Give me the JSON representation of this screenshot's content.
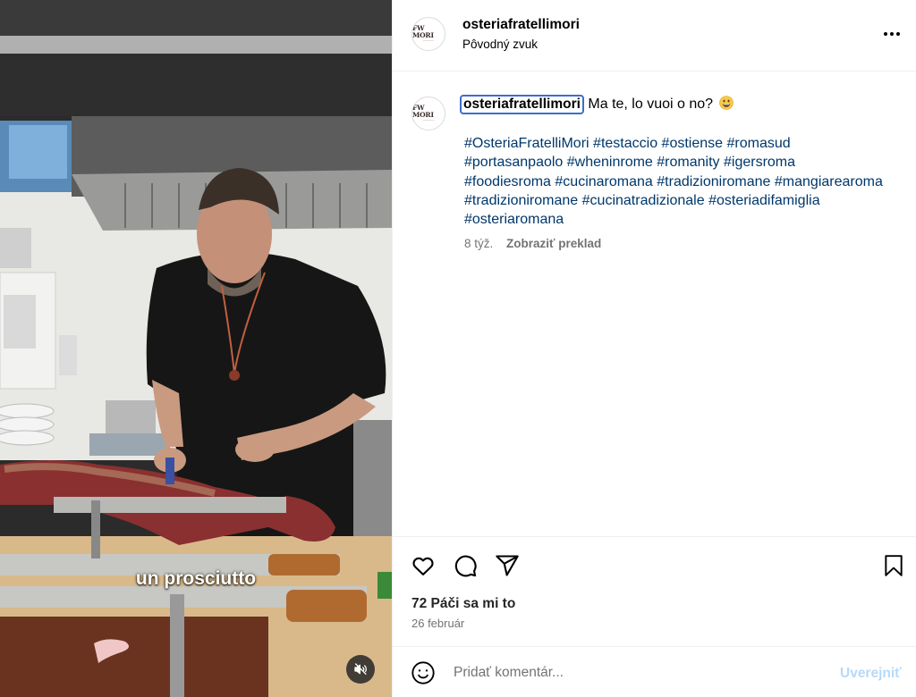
{
  "video": {
    "subtitle": "un prosciutto",
    "mute_icon": "speaker-muted-icon"
  },
  "header": {
    "avatar_logo": "FW MORI",
    "username": "osteriafratellimori",
    "audio": "Pôvodný zvuk",
    "more_icon": "more-horizontal-icon"
  },
  "caption": {
    "avatar_logo": "FW MORI",
    "username": "osteriafratellimori",
    "text": "Ma te, lo vuoi o no?",
    "emoji": "grinning-face-emoji",
    "hashtags": [
      "#OsteriaFratelliMori",
      "#testaccio",
      "#ostiense",
      "#romasud",
      "#portasanpaolo",
      "#wheninrome",
      "#romanity",
      "#igersroma",
      "#foodiesroma",
      "#cucinaromana",
      "#tradizioniromane",
      "#mangiarearoma",
      "#tradizioniromane",
      "#cucinatradizionale",
      "#osteriadifamiglia",
      "#osteriaromana"
    ],
    "age": "8 týž.",
    "translate": "Zobraziť preklad"
  },
  "actions": {
    "icons": [
      "heart-icon",
      "comment-icon",
      "share-icon",
      "bookmark-icon"
    ],
    "likes": "72 Páči sa mi to",
    "date": "26 február"
  },
  "comment": {
    "emoji_icon": "smiley-icon",
    "placeholder": "Pridať komentár...",
    "post": "Uverejniť"
  },
  "colors": {
    "hashtag": "#00376b",
    "secondary_text": "#737373",
    "post_disabled": "#b8d8f8",
    "focus_outline": "#3b6fc9"
  }
}
